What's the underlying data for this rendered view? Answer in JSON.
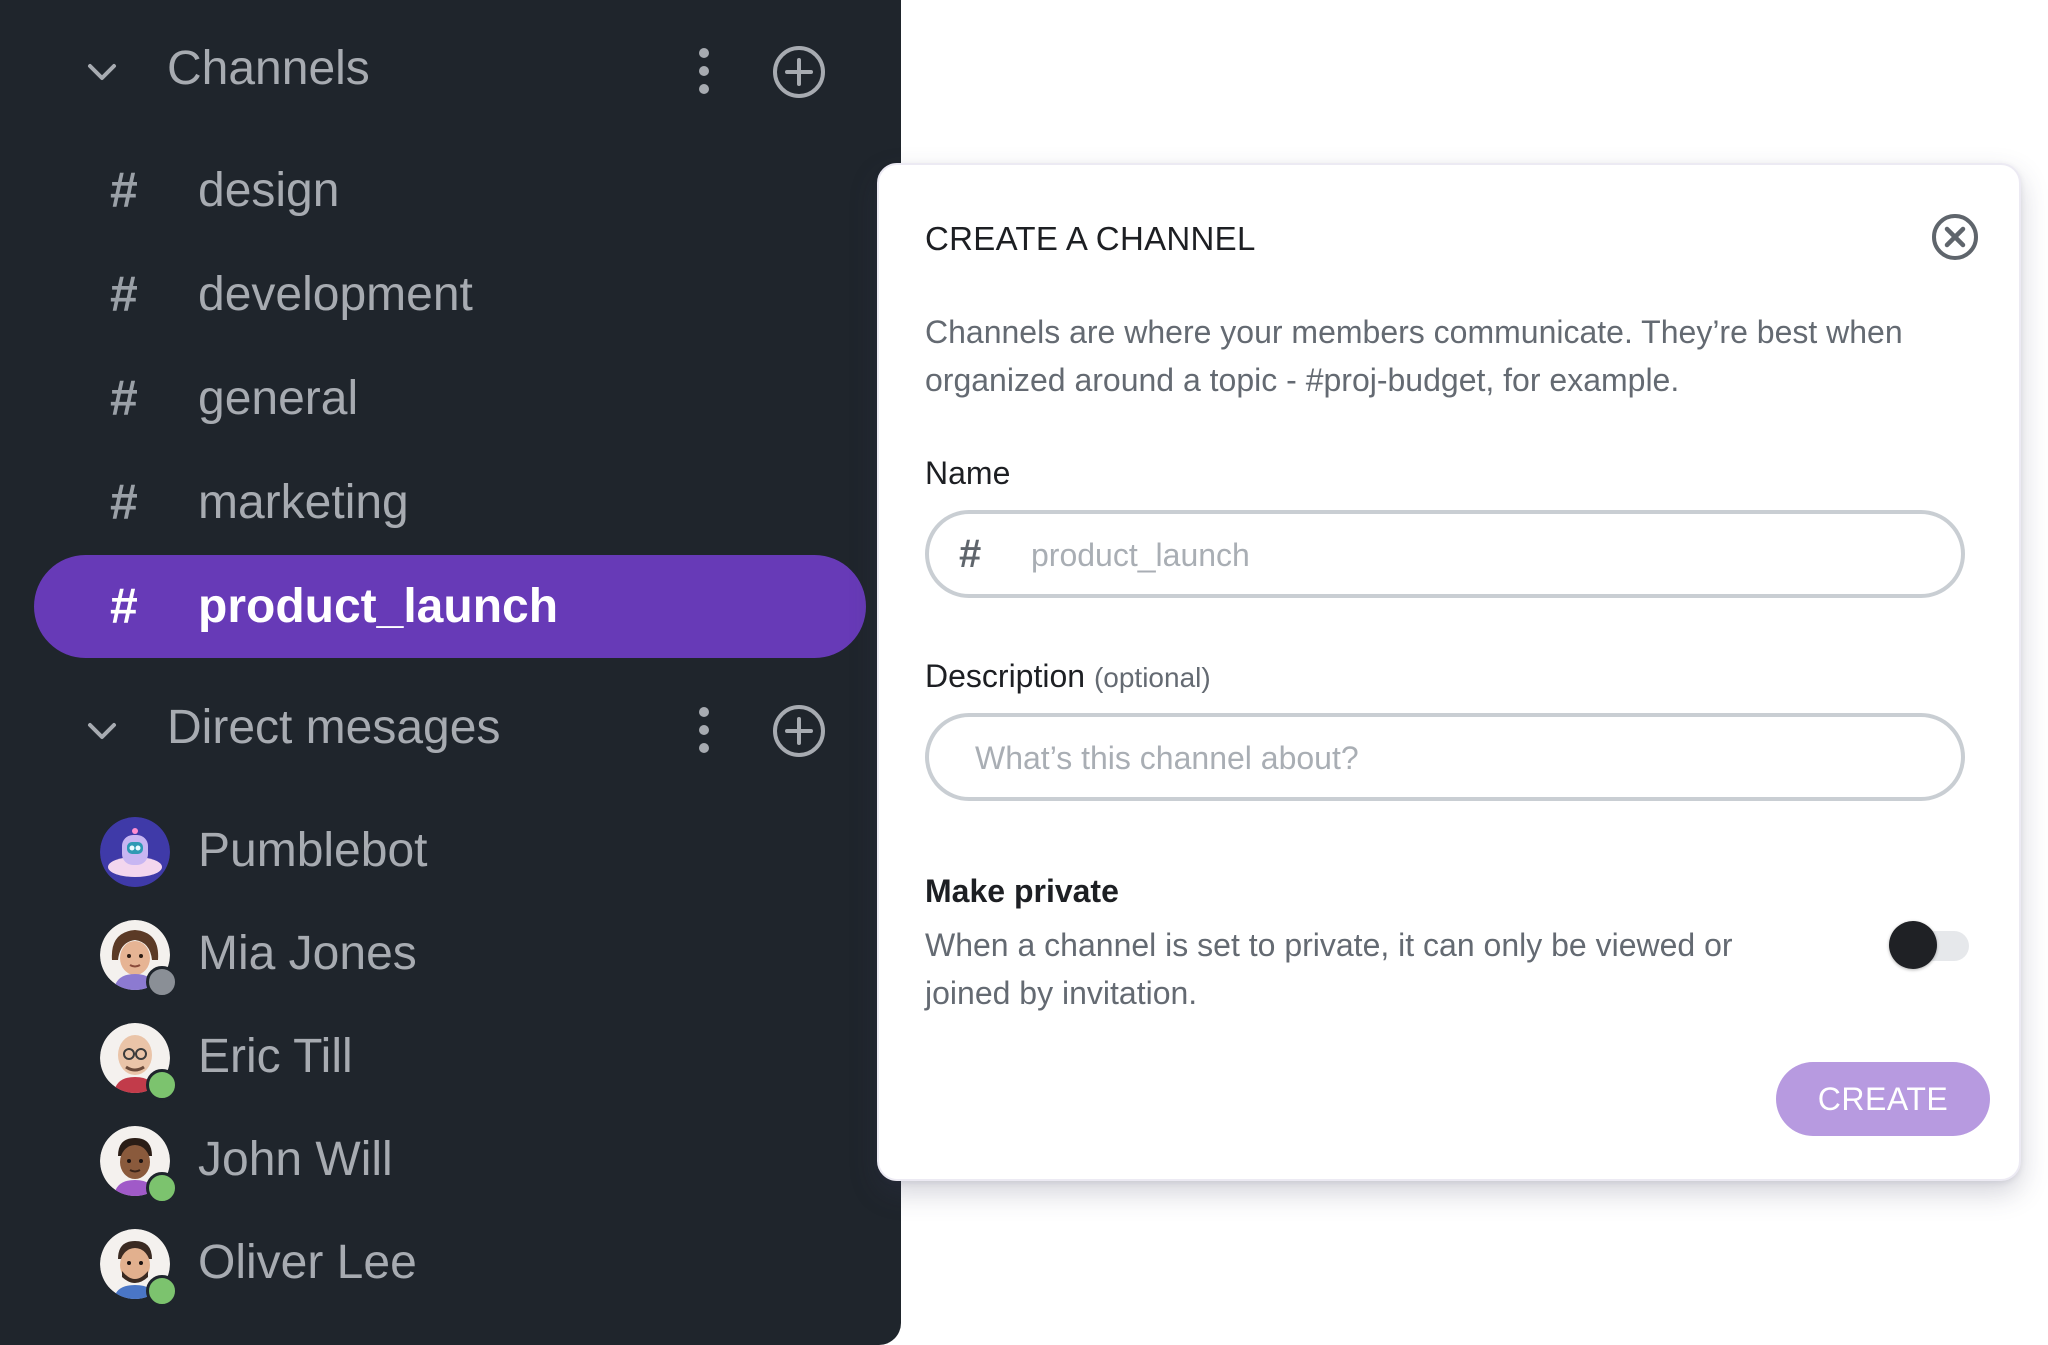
{
  "sidebar": {
    "channels_header": {
      "title": "Channels"
    },
    "channels": [
      {
        "label": "design",
        "active": false
      },
      {
        "label": "development",
        "active": false
      },
      {
        "label": "general",
        "active": false
      },
      {
        "label": "marketing",
        "active": false
      },
      {
        "label": "product_launch",
        "active": true
      }
    ],
    "channel_hash": "#",
    "dm_header": {
      "title": "Direct mesages"
    },
    "direct_messages": [
      {
        "label": "Pumblebot",
        "status": "none"
      },
      {
        "label": "Mia Jones",
        "status": "offline"
      },
      {
        "label": "Eric Till",
        "status": "away"
      },
      {
        "label": "John Will",
        "status": "online"
      },
      {
        "label": "Oliver Lee",
        "status": "away"
      }
    ]
  },
  "modal": {
    "title": "CREATE A CHANNEL",
    "description": "Channels are where your members communicate. They’re best when organized around a topic - #proj-budget, for example.",
    "name_label": "Name",
    "name_prefix": "#",
    "name_placeholder": "product_launch",
    "name_value": "",
    "description_label": "Description",
    "description_optional": "(optional)",
    "description_placeholder": "What’s this channel about?",
    "description_value": "",
    "private_title": "Make private",
    "private_desc": "When a channel is set to private, it can only be viewed or joined by invitation.",
    "private_enabled": false,
    "create_label": "CREATE"
  },
  "colors": {
    "sidebar_bg": "#1f252c",
    "accent": "#673ab7",
    "create_button": "#b79ae0",
    "online": "#7cc36e",
    "offline": "#8a8f96"
  }
}
